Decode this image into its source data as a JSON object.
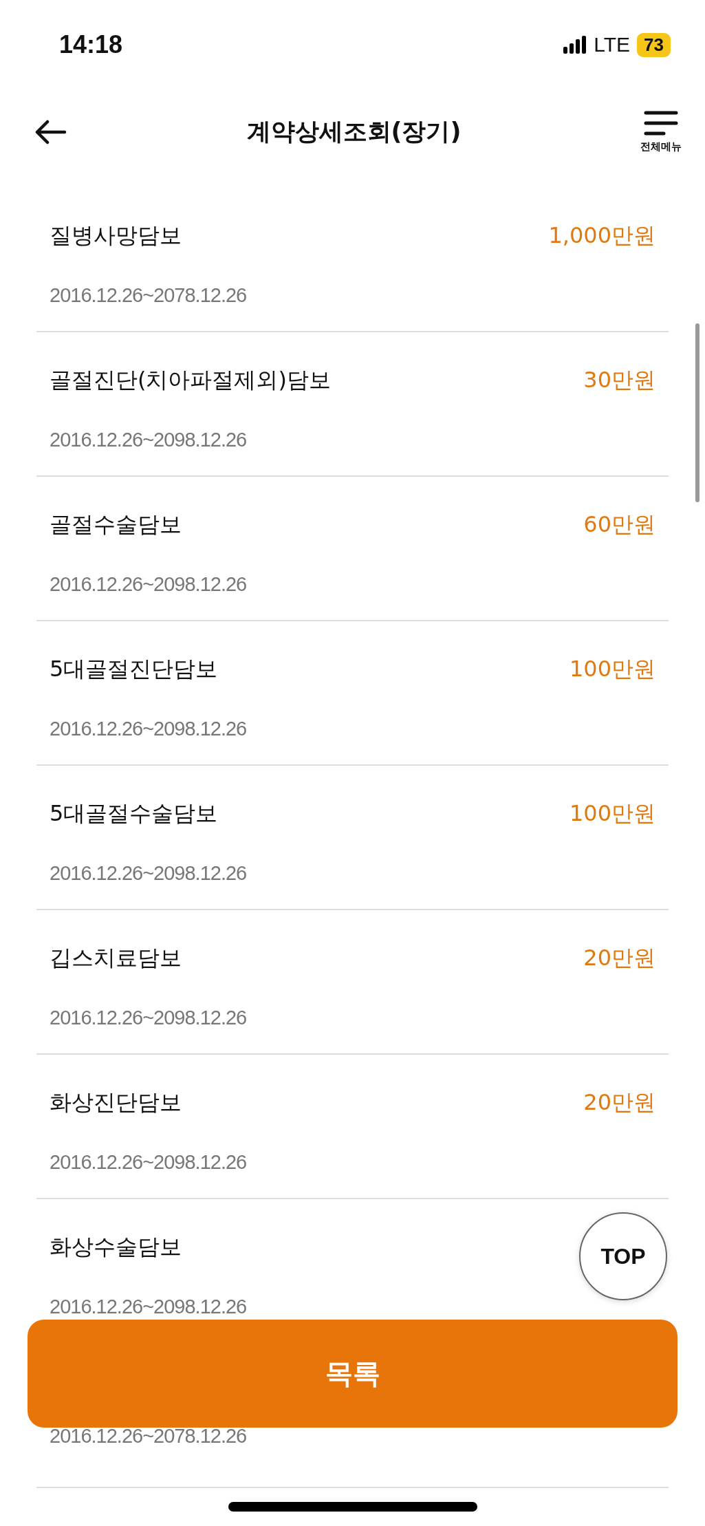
{
  "status_bar": {
    "time": "14:18",
    "network": "LTE",
    "battery": "73"
  },
  "header": {
    "title": "계약상세조회(장기)",
    "menu_label": "전체메뉴"
  },
  "coverages": [
    {
      "name": "질병사망담보",
      "period": "2016.12.26~2078.12.26",
      "amount": "1,000만원"
    },
    {
      "name": "골절진단(치아파절제외)담보",
      "period": "2016.12.26~2098.12.26",
      "amount": "30만원"
    },
    {
      "name": "골절수술담보",
      "period": "2016.12.26~2098.12.26",
      "amount": "60만원"
    },
    {
      "name": "5대골절진단담보",
      "period": "2016.12.26~2098.12.26",
      "amount": "100만원"
    },
    {
      "name": "5대골절수술담보",
      "period": "2016.12.26~2098.12.26",
      "amount": "100만원"
    },
    {
      "name": "깁스치료담보",
      "period": "2016.12.26~2098.12.26",
      "amount": "20만원"
    },
    {
      "name": "화상진단담보",
      "period": "2016.12.26~2098.12.26",
      "amount": "20만원"
    },
    {
      "name": "화상수술담보",
      "period": "2016.12.26~2098.12.26"
    },
    {
      "period": "2016.12.26~2078.12.26"
    }
  ],
  "top_button": "TOP",
  "list_button": "목록"
}
